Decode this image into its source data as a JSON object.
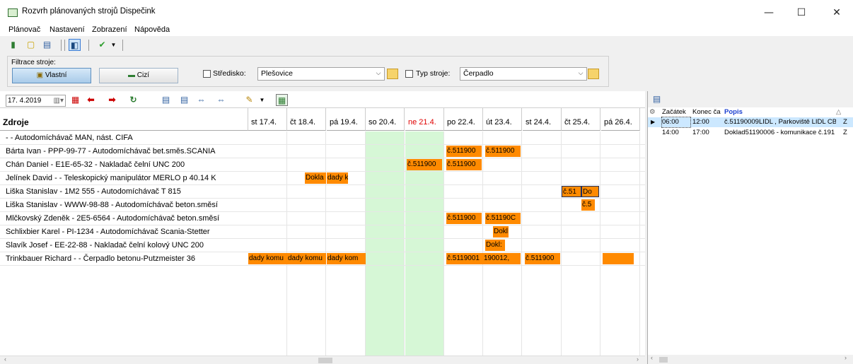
{
  "window": {
    "title": "Rozvrh plánovaných strojů Dispečink",
    "minimize": "—",
    "maximize": "☐",
    "close": "✕"
  },
  "menu": [
    "Plánovač",
    "Nastavení",
    "Zobrazení",
    "Nápověda"
  ],
  "filter": {
    "group_label": "Filtrace stroje:",
    "own_label": "Vlastní",
    "foreign_label": "Cizí",
    "center_label": "Středisko:",
    "center_value": "Plešovice",
    "type_label": "Typ stroje:",
    "type_value": "Čerpadlo"
  },
  "toolbar2": {
    "date": "17. 4.2019"
  },
  "grid": {
    "resource_header": "Zdroje",
    "days": [
      {
        "label": "st 17.4.",
        "weekend": false,
        "holiday": false
      },
      {
        "label": "čt 18.4.",
        "weekend": false,
        "holiday": false
      },
      {
        "label": "pá 19.4.",
        "weekend": false,
        "holiday": false
      },
      {
        "label": "so 20.4.",
        "weekend": true,
        "holiday": false
      },
      {
        "label": "ne 21.4.",
        "weekend": true,
        "holiday": true
      },
      {
        "label": "po 22.4.",
        "weekend": false,
        "holiday": false
      },
      {
        "label": "út 23.4.",
        "weekend": false,
        "holiday": false
      },
      {
        "label": "st 24.4.",
        "weekend": false,
        "holiday": false
      },
      {
        "label": "čt 25.4.",
        "weekend": false,
        "holiday": false
      },
      {
        "label": "pá 26.4.",
        "weekend": false,
        "holiday": false
      }
    ],
    "rows": [
      {
        "label": "-  - Autodomíchávač MAN, nást. CIFA",
        "bars": []
      },
      {
        "label": "Bárta Ivan - PPP-99-77 - Autodomíchávač bet.směs.SCANIA",
        "bars": [
          {
            "day": 5,
            "start": 0.05,
            "end": 0.95,
            "text": "č.511900"
          },
          {
            "day": 6,
            "start": 0.05,
            "end": 0.95,
            "text": "č.511900"
          }
        ]
      },
      {
        "label": "Chán Daniel - E1E-65-32 - Nakladač čelní UNC 200",
        "bars": [
          {
            "day": 4,
            "start": 0.05,
            "end": 0.95,
            "text": "č.511900"
          },
          {
            "day": 5,
            "start": 0.05,
            "end": 0.95,
            "text": "č.511900"
          }
        ]
      },
      {
        "label": "Jelínek David -  - Teleskopický manipulátor MERLO p 40.14 K",
        "bars": [
          {
            "day": 1,
            "start": 0.45,
            "end": 1.0,
            "text": "Dokla"
          },
          {
            "day": 2,
            "start": 0.0,
            "end": 0.55,
            "text": "dady kom"
          }
        ]
      },
      {
        "label": "Liška Stanislav - 1M2 555 - Autodomíchávač T 815",
        "bars": [
          {
            "day": 8,
            "start": 0.0,
            "end": 0.5,
            "text": "č.51",
            "selected": true
          },
          {
            "day": 8,
            "start": 0.5,
            "end": 0.95,
            "text": "Do",
            "selected": true
          }
        ]
      },
      {
        "label": "Liška Stanislav - WWW-98-88 - Autodomíchávač beton.směsí",
        "bars": [
          {
            "day": 8,
            "start": 0.5,
            "end": 0.85,
            "text": "č.5"
          }
        ]
      },
      {
        "label": "Mlčkovský Zdeněk - 2E5-6564 - Autodomíchávač beton.směsí",
        "bars": [
          {
            "day": 5,
            "start": 0.05,
            "end": 0.95,
            "text": "č.511900"
          },
          {
            "day": 6,
            "start": 0.05,
            "end": 0.95,
            "text": "č.51190C"
          }
        ]
      },
      {
        "label": "Schlixbier Karel - PI-1234 - Autodomíchávač Scania-Stetter",
        "bars": [
          {
            "day": 6,
            "start": 0.25,
            "end": 0.65,
            "text": "Dokl"
          }
        ]
      },
      {
        "label": "Slavík Josef - EE-22-88 - Nakladač čelní kolový UNC 200",
        "bars": [
          {
            "day": 6,
            "start": 0.05,
            "end": 0.55,
            "text": "Dokl:"
          }
        ]
      },
      {
        "label": "Trinkbauer Richard -  - Čerpadlo betonu-Putzmeister 36",
        "bars": [
          {
            "day": 0,
            "start": 0.0,
            "end": 1.0,
            "text": "dady komu"
          },
          {
            "day": 1,
            "start": 0.0,
            "end": 1.0,
            "text": "dady komu"
          },
          {
            "day": 2,
            "start": 0.0,
            "end": 1.0,
            "text": "dady kom"
          },
          {
            "day": 5,
            "start": 0.05,
            "end": 1.0,
            "text": "č.5119001"
          },
          {
            "day": 6,
            "start": 0.0,
            "end": 0.95,
            "text": "190012,"
          },
          {
            "day": 7,
            "start": 0.05,
            "end": 0.95,
            "text": "č.511900"
          },
          {
            "day": 9,
            "start": 0.05,
            "end": 0.85,
            "text": ""
          }
        ]
      }
    ]
  },
  "detail": {
    "headers": [
      "Začátek",
      "Konec ča",
      "Popis"
    ],
    "rows": [
      {
        "start": "06:00",
        "end": "12:00",
        "desc": "č.51190009LIDL , Parkoviště LIDL CB",
        "extra": "Z",
        "selected": true
      },
      {
        "start": "14:00",
        "end": "17:00",
        "desc": "Doklad51190006 - komunikace č.191",
        "extra": "Z",
        "selected": false
      }
    ]
  },
  "colors": {
    "bar": "#ff8a00",
    "weekend": "#d6f7d6",
    "holiday_text": "#e00000",
    "selected_row": "#cce8ff"
  }
}
